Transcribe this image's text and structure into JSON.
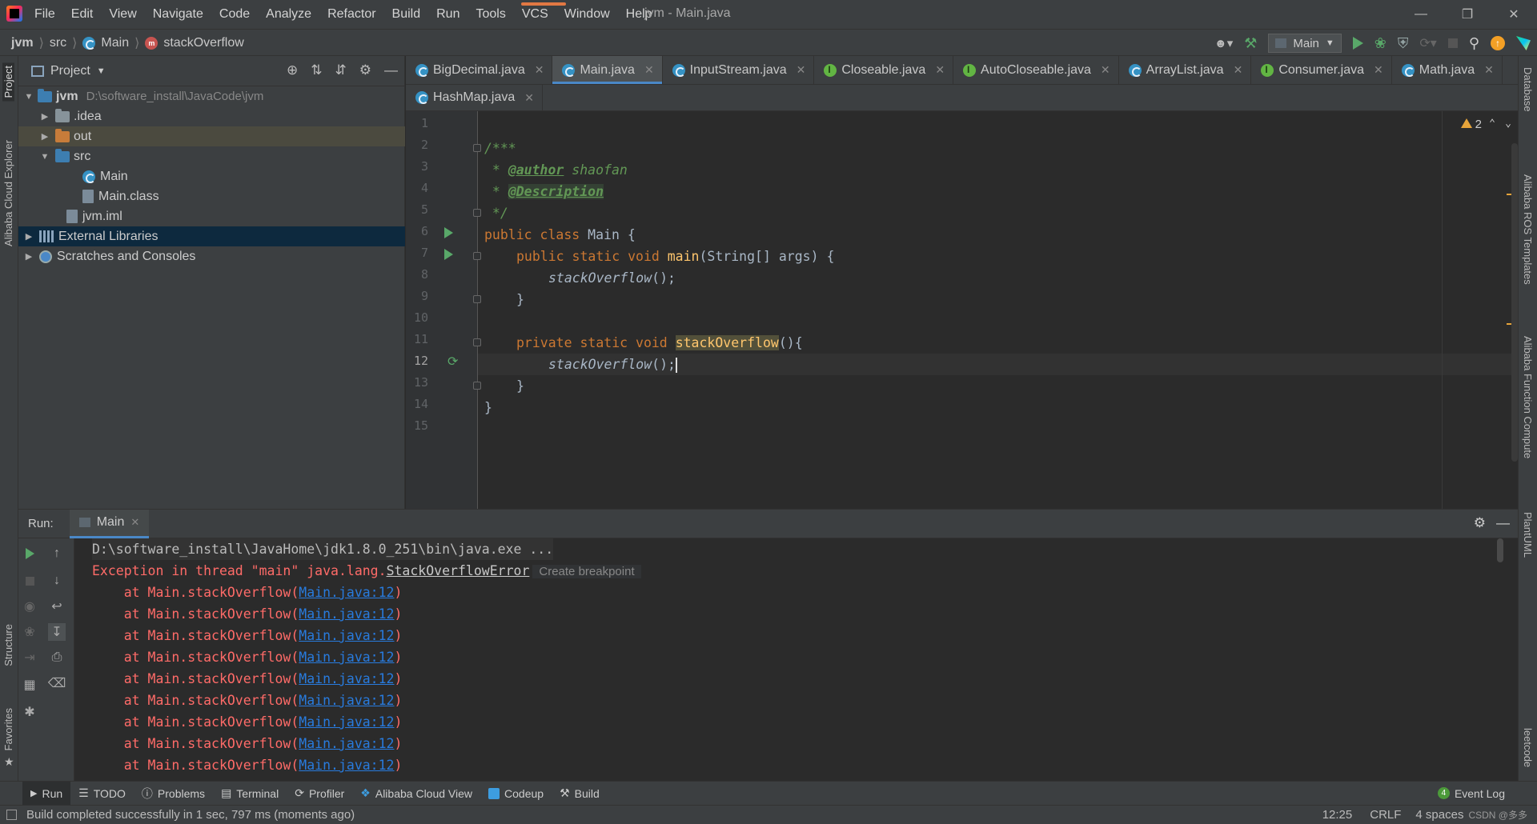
{
  "menubar": {
    "items": [
      "File",
      "Edit",
      "View",
      "Navigate",
      "Code",
      "Analyze",
      "Refactor",
      "Build",
      "Run",
      "Tools",
      "VCS",
      "Window",
      "Help"
    ],
    "window_title": "jvm - Main.java"
  },
  "navbar": {
    "crumbs": [
      "jvm",
      "src",
      "Main",
      "stackOverflow"
    ],
    "run_config": "Main"
  },
  "left_strip": {
    "project": "Project",
    "cloud_explorer": "Alibaba Cloud Explorer",
    "structure": "Structure",
    "favorites": "Favorites"
  },
  "right_strip": {
    "database": "Database",
    "ros": "Alibaba ROS Templates",
    "function_compute": "Alibaba Function Compute",
    "plantuml": "PlantUML",
    "leetcode": "leetcode"
  },
  "project": {
    "title": "Project",
    "tree": [
      {
        "label": "jvm",
        "path": "D:\\software_install\\JavaCode\\jvm"
      },
      {
        "label": ".idea"
      },
      {
        "label": "out"
      },
      {
        "label": "src"
      },
      {
        "label": "Main"
      },
      {
        "label": "Main.class"
      },
      {
        "label": "jvm.iml"
      },
      {
        "label": "External Libraries"
      },
      {
        "label": "Scratches and Consoles"
      }
    ]
  },
  "tabs": [
    "BigDecimal.java",
    "Main.java",
    "InputStream.java",
    "Closeable.java",
    "AutoCloseable.java",
    "ArrayList.java",
    "Consumer.java",
    "Math.java",
    "HashMap.java"
  ],
  "editor": {
    "warnings": "2",
    "line_numbers": [
      "1",
      "2",
      "3",
      "4",
      "5",
      "6",
      "7",
      "8",
      "9",
      "10",
      "11",
      "12",
      "13",
      "14",
      "15"
    ],
    "code": {
      "l2": "/***",
      "l3_star": " * ",
      "l3_tag": "@author",
      "l3_rest": " shaofan",
      "l4_star": " * ",
      "l4_tag": "@Description",
      "l5": " */",
      "l6_kw": "public class",
      "l6_rest": " Main {",
      "l7_kw": "public static void",
      "l7_fn": "main",
      "l7_rest": "(String[] args) {",
      "l8": "stackOverflow",
      "l8_rest": "();",
      "l9": "}",
      "l11_kw": "private static void",
      "l11_fn": "stackOverflow",
      "l11_rest": "(){",
      "l12": "stackOverflow",
      "l12_rest": "();",
      "l13": "}",
      "l14": "}"
    }
  },
  "run": {
    "label": "Run:",
    "tab": "Main",
    "cmd": "D:\\software_install\\JavaHome\\jdk1.8.0_251\\bin\\java.exe ...",
    "exception_prefix": "Exception in thread \"main\" java.lang.",
    "exception_class": "StackOverflowError",
    "create_breakpoint": "Create breakpoint",
    "frame_prefix": "    at Main.stackOverflow(",
    "frame_link": "Main.java:12",
    "frame_suffix": ")"
  },
  "toolwindows": [
    "Run",
    "TODO",
    "Problems",
    "Terminal",
    "Profiler",
    "Alibaba Cloud View",
    "Codeup",
    "Build"
  ],
  "event_log": "Event Log",
  "status": {
    "message": "Build completed successfully in 1 sec, 797 ms (moments ago)",
    "position": "12:25",
    "line_sep": "CRLF",
    "indent": "4 spaces",
    "watermark": "CSDN @多多"
  }
}
